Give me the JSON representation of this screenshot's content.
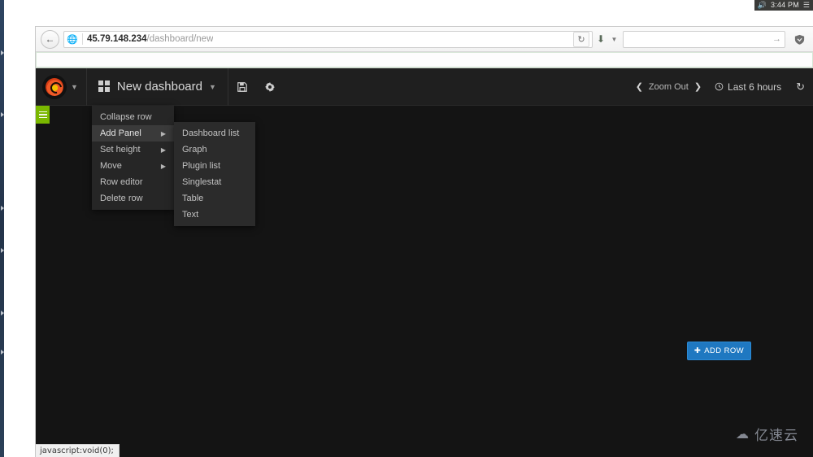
{
  "colors": {
    "grafana_orange": "#f05a28",
    "row_green": "#7ab800",
    "add_row_blue": "#1f78c1",
    "page_bg": "#141414",
    "navbar_bg": "#1f1f1f",
    "menu_bg": "#262626"
  },
  "systray": {
    "volume_icon": "speaker-icon",
    "time": "3:44 PM",
    "network_icon": "network-icon"
  },
  "browser": {
    "back_icon": "back-arrow-icon",
    "site_icon": "globe-icon",
    "url_host": "45.79.148.234",
    "url_path": "/dashboard/new",
    "reload_icon": "reload-icon",
    "download_icon": "download-icon",
    "download_caret_icon": "chevron-down-icon",
    "search_placeholder": "",
    "search_value": "",
    "search_go_icon": "arrow-right-icon",
    "shield_icon": "shield-icon"
  },
  "grafana": {
    "logo_icon": "grafana-logo-icon",
    "logo_caret_icon": "chevron-down-icon",
    "dashboard_grid_icon": "dashboard-grid-icon",
    "dashboard_title": "New dashboard",
    "dashboard_caret_icon": "chevron-down-icon",
    "save_icon": "save-icon",
    "settings_icon": "gear-icon",
    "zoom_prev_icon": "chevron-left-icon",
    "zoom_out_label": "Zoom Out",
    "zoom_next_icon": "chevron-right-icon",
    "time_clock_icon": "clock-icon",
    "time_range_label": "Last 6 hours",
    "refresh_icon": "refresh-icon",
    "row_handle_icon": "hamburger-icon",
    "add_row_plus_icon": "plus-icon",
    "add_row_label": "ADD ROW"
  },
  "row_menu": {
    "items": [
      {
        "label": "Collapse row",
        "has_submenu": false,
        "active": false
      },
      {
        "label": "Add Panel",
        "has_submenu": true,
        "active": true
      },
      {
        "label": "Set height",
        "has_submenu": true,
        "active": false
      },
      {
        "label": "Move",
        "has_submenu": true,
        "active": false
      },
      {
        "label": "Row editor",
        "has_submenu": false,
        "active": false
      },
      {
        "label": "Delete row",
        "has_submenu": false,
        "active": false
      }
    ],
    "submenu_arrow_icon": "caret-right-icon"
  },
  "panel_menu": {
    "items": [
      {
        "label": "Dashboard list"
      },
      {
        "label": "Graph"
      },
      {
        "label": "Plugin list"
      },
      {
        "label": "Singlestat"
      },
      {
        "label": "Table"
      },
      {
        "label": "Text"
      }
    ]
  },
  "statusbar": {
    "text": "javascript:void(0);"
  },
  "watermark": {
    "icon": "cloud-icon",
    "text": "亿速云"
  }
}
